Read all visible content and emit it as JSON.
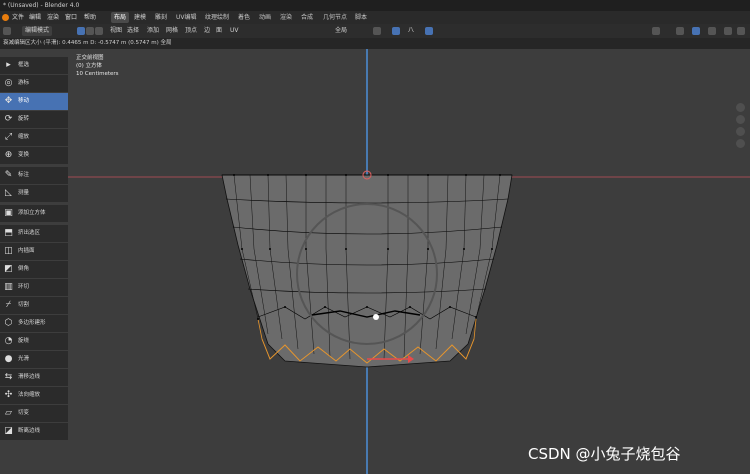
{
  "titlebar": {
    "title": "* (Unsaved) - Blender 4.0"
  },
  "menubar": {
    "items": [
      "文件",
      "编辑",
      "渲染",
      "窗口",
      "帮助"
    ],
    "tabs": [
      "布局",
      "建模",
      "雕刻",
      "UV编辑",
      "纹理绘制",
      "着色",
      "动画",
      "渲染",
      "合成",
      "几何节点",
      "脚本"
    ],
    "active_tab": 0
  },
  "header": {
    "mode": "编辑模式",
    "menus": [
      "视图",
      "选择",
      "添加",
      "网格",
      "顶点",
      "边",
      "面",
      "UV"
    ],
    "orientation": "全局",
    "snap": "八"
  },
  "status": {
    "text": "衰减编辑区大小 (平滑): 0.4465 m   D: -0.5747 m (0.5747 m) 全局"
  },
  "overlay": {
    "view": "正交前视图",
    "object": "(0) 立方体",
    "scale": "10 Centimeters"
  },
  "tools": [
    {
      "label": "框选",
      "icon": "cursor-icon"
    },
    {
      "label": "游标",
      "icon": "cursor-target-icon"
    },
    {
      "label": "移动",
      "icon": "move-icon"
    },
    {
      "label": "旋转",
      "icon": "rotate-icon"
    },
    {
      "label": "缩放",
      "icon": "scale-icon"
    },
    {
      "label": "变换",
      "icon": "transform-icon"
    },
    {
      "label": "标注",
      "icon": "annotate-icon"
    },
    {
      "label": "测量",
      "icon": "measure-icon"
    },
    {
      "label": "添加立方体",
      "icon": "add-cube-icon"
    },
    {
      "label": "挤出选区",
      "icon": "extrude-icon"
    },
    {
      "label": "内插面",
      "icon": "inset-icon"
    },
    {
      "label": "倒角",
      "icon": "bevel-icon"
    },
    {
      "label": "环切",
      "icon": "loop-cut-icon"
    },
    {
      "label": "切割",
      "icon": "knife-icon"
    },
    {
      "label": "多边形建形",
      "icon": "poly-build-icon"
    },
    {
      "label": "旋绕",
      "icon": "spin-icon"
    },
    {
      "label": "光滑",
      "icon": "smooth-icon"
    },
    {
      "label": "滑移边线",
      "icon": "edge-slide-icon"
    },
    {
      "label": "法向缩放",
      "icon": "shrink-icon"
    },
    {
      "label": "切变",
      "icon": "shear-icon"
    },
    {
      "label": "断离边线",
      "icon": "rip-icon"
    }
  ],
  "active_tool": 2,
  "watermark": "CSDN @小兔子烧包谷"
}
